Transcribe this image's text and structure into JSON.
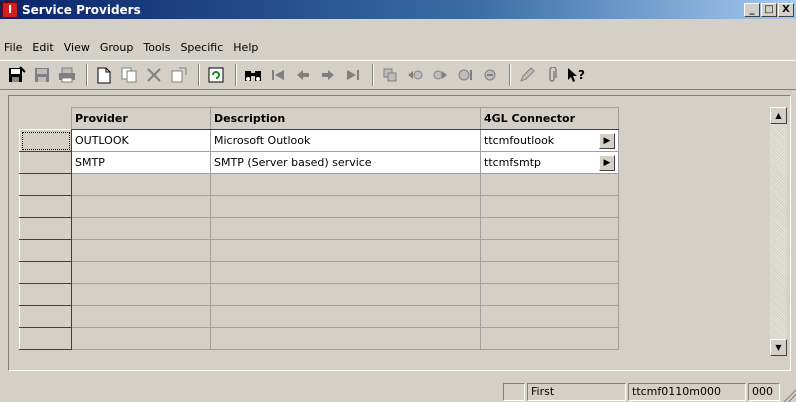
{
  "window": {
    "title": "Service Providers",
    "app_icon_glyph": "I",
    "controls": [
      "_",
      "□",
      "X"
    ]
  },
  "menu": [
    "File",
    "Edit",
    "View",
    "Group",
    "Tools",
    "Specific",
    "Help"
  ],
  "toolbar": {
    "icons": [
      "save-and-close-icon",
      "save-icon",
      "print-icon",
      "new-icon",
      "copy-icon",
      "delete-icon",
      "duplicate-icon",
      "refresh-icon",
      "find-icon",
      "first-record-icon",
      "previous-record-icon",
      "next-record-icon",
      "last-record-icon",
      "group-first-icon",
      "group-previous-icon",
      "group-next-icon",
      "group-last-icon",
      "edit-text-icon",
      "attachment-icon",
      "whats-this-help-icon"
    ]
  },
  "grid": {
    "columns": [
      "Provider",
      "Description",
      "4GL Connector"
    ],
    "rows": [
      {
        "provider": "OUTLOOK",
        "description": "Microsoft Outlook",
        "connector": "ttcmfoutlook"
      },
      {
        "provider": "SMTP",
        "description": "SMTP (Server based) service",
        "connector": "ttcmfsmtp"
      }
    ],
    "empty_row_count": 8,
    "zoom_glyph": "▶"
  },
  "scrollbar": {
    "up": "▲",
    "down": "▼"
  },
  "status": {
    "blank": "",
    "record": "First",
    "session": "ttcmf0110m000",
    "company": "000"
  },
  "colors": {
    "titlebar_start": "#0a246a",
    "titlebar_end": "#a6caf0",
    "chrome": "#d4d0c8"
  }
}
